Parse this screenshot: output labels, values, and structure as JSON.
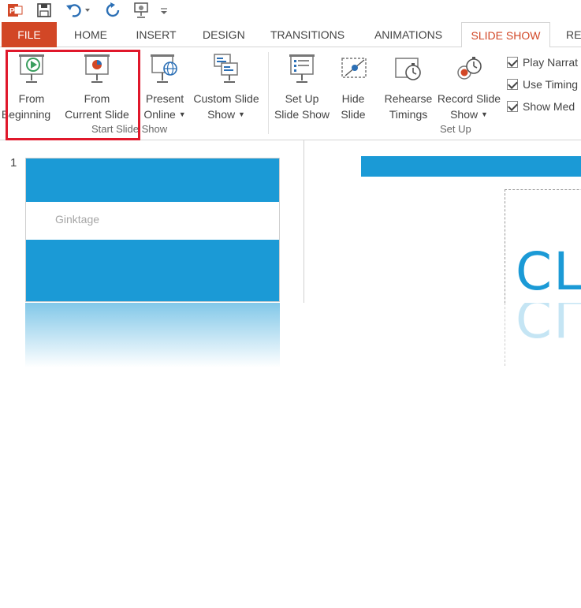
{
  "quick_access": {
    "icons": [
      "powerpoint-logo-icon",
      "save-icon",
      "undo-icon",
      "redo-icon",
      "present-icon",
      "customize-icon"
    ]
  },
  "tabs": [
    {
      "label": "FILE"
    },
    {
      "label": "HOME"
    },
    {
      "label": "INSERT"
    },
    {
      "label": "DESIGN"
    },
    {
      "label": "TRANSITIONS"
    },
    {
      "label": "ANIMATIONS"
    },
    {
      "label": "SLIDE SHOW"
    },
    {
      "label": "RE"
    }
  ],
  "ribbon": {
    "start_group": {
      "label": "Start Slide Show",
      "from_beginning": {
        "line1": "From",
        "line2": "Beginning"
      },
      "from_current": {
        "line1": "From",
        "line2": "Current Slide"
      },
      "present_online": {
        "line1": "Present",
        "line2": "Online"
      },
      "custom_show": {
        "line1": "Custom Slide",
        "line2": "Show"
      }
    },
    "setup_group": {
      "label": "Set Up",
      "setup_show": {
        "line1": "Set Up",
        "line2": "Slide Show"
      },
      "hide_slide": {
        "line1": "Hide",
        "line2": "Slide"
      },
      "rehearse": {
        "line1": "Rehearse",
        "line2": "Timings"
      },
      "record": {
        "line1": "Record Slide",
        "line2": "Show"
      }
    },
    "checkboxes": [
      {
        "label": "Play Narrat",
        "checked": true
      },
      {
        "label": "Use Timing",
        "checked": true
      },
      {
        "label": "Show Med",
        "checked": true
      }
    ]
  },
  "slides_pane": {
    "slide_number": "1",
    "thumb_text": "Ginktage"
  },
  "main_slide": {
    "title_text": "CL"
  },
  "colors": {
    "accent_blue": "#1b9ad6",
    "file_tab": "#d24726",
    "highlight_red": "#e0182b"
  }
}
